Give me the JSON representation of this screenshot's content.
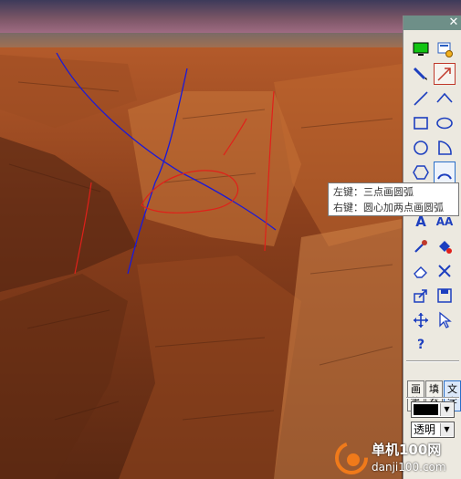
{
  "toolbar": {
    "close_glyph": "✕",
    "tools": [
      {
        "name": "screen-icon"
      },
      {
        "name": "settings-icon"
      },
      {
        "name": "pen-icon"
      },
      {
        "name": "arrow-line-icon",
        "selected": true
      },
      {
        "name": "line-icon"
      },
      {
        "name": "polyline-icon"
      },
      {
        "name": "rectangle-icon"
      },
      {
        "name": "ellipse-icon"
      },
      {
        "name": "circle-icon"
      },
      {
        "name": "sector-icon"
      },
      {
        "name": "hexagon-icon"
      },
      {
        "name": "arc-icon",
        "selected": true
      },
      {
        "name": "text-a-icon"
      },
      {
        "name": "text-aa-icon"
      },
      {
        "name": "pipette-icon"
      },
      {
        "name": "fill-icon"
      },
      {
        "name": "eraser-icon"
      },
      {
        "name": "delete-icon"
      },
      {
        "name": "export-icon"
      },
      {
        "name": "save-icon"
      },
      {
        "name": "move-icon"
      },
      {
        "name": "pointer-icon"
      },
      {
        "name": "help-icon"
      }
    ],
    "text_a": "A",
    "text_aa": "AA",
    "help": "?",
    "modes": [
      {
        "label": "画笔",
        "active": false
      },
      {
        "label": "填充",
        "active": false
      },
      {
        "label": "文字",
        "active": true
      }
    ],
    "color_select": {
      "value": "#000000"
    },
    "transparency_select": {
      "value": "透明"
    },
    "arrow_glyph": "▼"
  },
  "tooltip": {
    "line1": "左键：三点画圆弧",
    "line2": "右键：圆心加两点画圆弧"
  },
  "watermark": {
    "line1": "单机100网",
    "line2": "danji100.com"
  },
  "colors": {
    "annotation_blue": "#1a1ad8",
    "annotation_red": "#e0201a",
    "toolbar_bg": "#ece9e0"
  }
}
